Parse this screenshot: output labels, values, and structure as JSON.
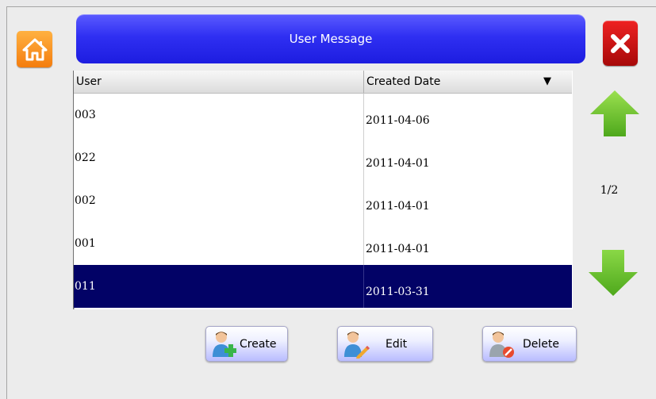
{
  "header": {
    "title": "User Message"
  },
  "table": {
    "columns": [
      "User",
      "Created Date"
    ],
    "sort_indicator": "▼",
    "rows": [
      {
        "user": "003",
        "date": "2011-04-06",
        "selected": false
      },
      {
        "user": "022",
        "date": "2011-04-01",
        "selected": false
      },
      {
        "user": "002",
        "date": "2011-04-01",
        "selected": false
      },
      {
        "user": "001",
        "date": "2011-04-01",
        "selected": false
      },
      {
        "user": "011",
        "date": "2011-03-31",
        "selected": true
      }
    ]
  },
  "pagination": {
    "page_label": "1/2"
  },
  "actions": {
    "create_label": "Create",
    "edit_label": "Edit",
    "delete_label": "Delete"
  },
  "icons": {
    "home": "home-icon",
    "close": "close-icon",
    "up": "arrow-up-icon",
    "down": "arrow-down-icon",
    "create": "user-add-icon",
    "edit": "user-edit-icon",
    "delete": "user-delete-icon"
  },
  "colors": {
    "title_bar": "#2f2ff2",
    "selected_row": "#020266",
    "home_button": "#f68a1a",
    "close_button": "#d51616",
    "arrow": "#6cc62b"
  }
}
